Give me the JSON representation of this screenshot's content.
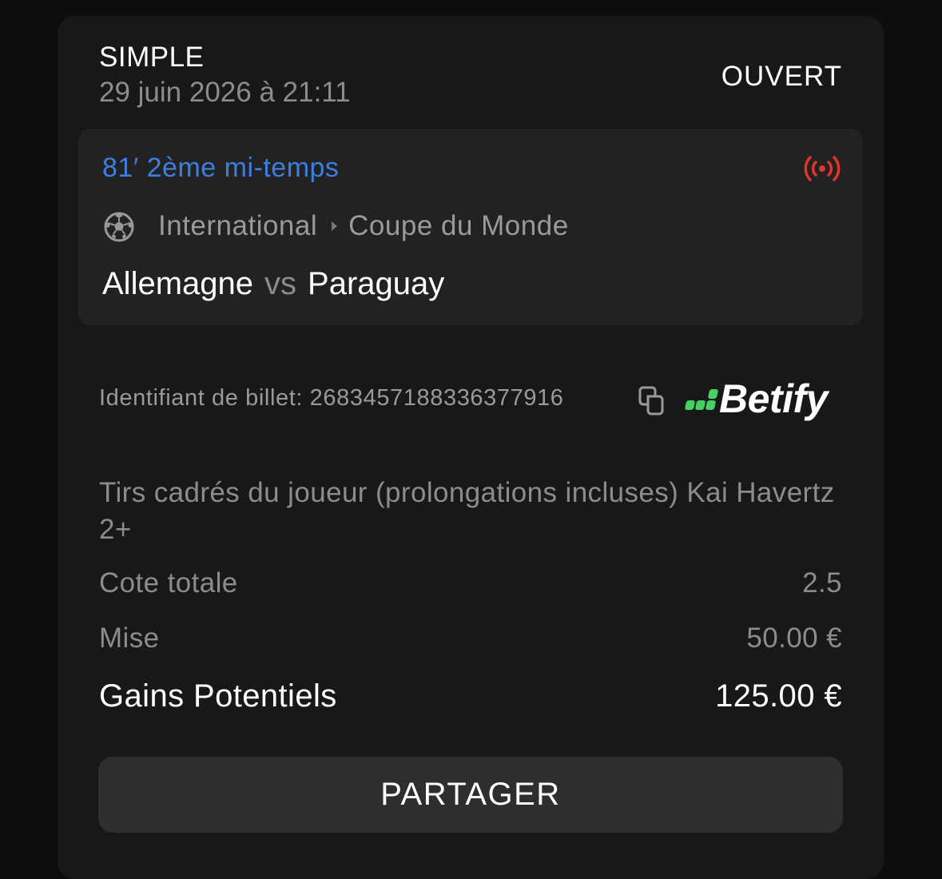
{
  "bet": {
    "type": "SIMPLE",
    "date": "29 juin 2026 à 21:11",
    "status": "OUVERT"
  },
  "match": {
    "time": "81′ 2ème mi-temps",
    "live_icon": "live-broadcast-icon",
    "sport_icon": "soccer-ball-icon",
    "region": "International",
    "competition": "Coupe du Monde",
    "home_team": "Allemagne",
    "vs": "vs",
    "away_team": "Paraguay"
  },
  "ticket": {
    "label": "Identifiant de billet: 2683457188336377916",
    "copy_icon": "copy-icon",
    "brand": "Betify",
    "brand_color": "#45d162"
  },
  "selection": {
    "market": "Tirs cadrés du joueur (prolongations incluses) Kai Havertz 2+"
  },
  "summary": {
    "odds_label": "Cote totale",
    "odds_value": "2.5",
    "stake_label": "Mise",
    "stake_value": "50.00 €",
    "payout_label": "Gains Potentiels",
    "payout_value": "125.00 €"
  },
  "actions": {
    "share_label": "PARTAGER"
  },
  "colors": {
    "background": "#0d0d0d",
    "card": "#181818",
    "match_box": "#222222",
    "accent_blue": "#3d7fe0",
    "live_red": "#e0352b"
  }
}
